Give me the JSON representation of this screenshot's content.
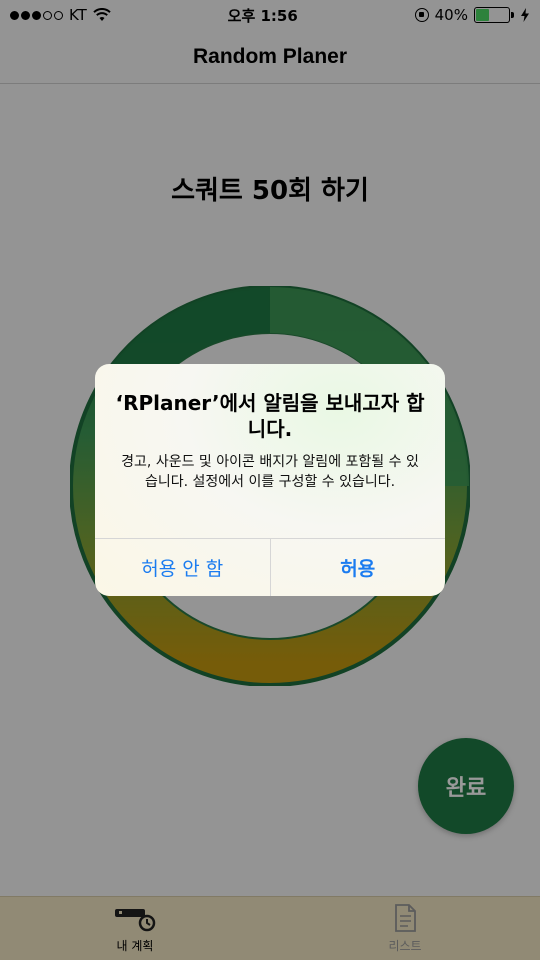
{
  "status_bar": {
    "carrier": "KT",
    "time": "오후 1:56",
    "battery_percent": "40%",
    "battery_level": 0.4,
    "signal_strength": 3
  },
  "nav": {
    "title": "Random Planer"
  },
  "task": {
    "title": "스쿼트 50회 하기"
  },
  "ring": {
    "colors": [
      "#1f7a45",
      "#3f9a57",
      "#7fa43a",
      "#c59a10"
    ]
  },
  "done_button": {
    "label": "완료"
  },
  "tabs": [
    {
      "label": "내 계획",
      "icon": "my-plan-icon",
      "active": true
    },
    {
      "label": "리스트",
      "icon": "list-document-icon",
      "active": false
    }
  ],
  "alert": {
    "title": "‘RPlaner’에서 알림을 보내고자 합니다.",
    "message": "경고, 사운드 및 아이콘 배지가 알림에 포함될 수 있습니다. 설정에서 이를 구성할 수 있습니다.",
    "deny_label": "허용 안 함",
    "allow_label": "허용"
  },
  "colors": {
    "accent_green": "#1f7a45",
    "alert_button_blue": "#1b7cf0",
    "tab_bar": "#f2e6c4"
  }
}
